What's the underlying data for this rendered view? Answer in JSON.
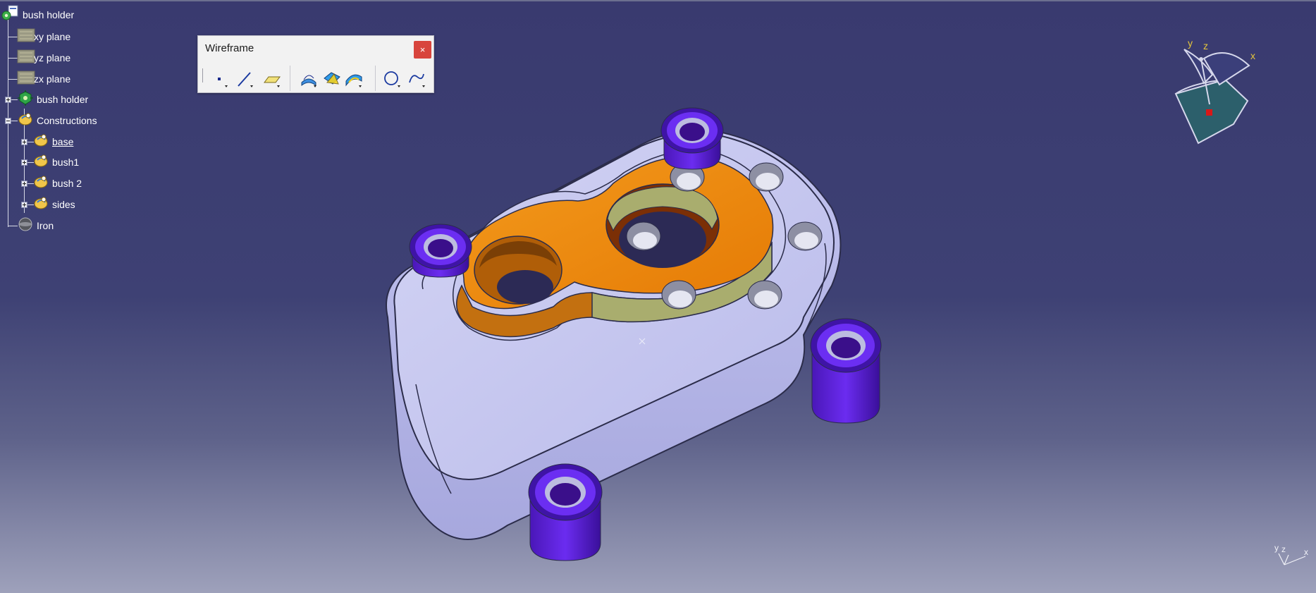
{
  "tree": {
    "root": {
      "label": "bush holder",
      "icon": "product-root-icon"
    },
    "items": [
      {
        "label": "xy plane",
        "icon": "plane-icon"
      },
      {
        "label": "yz plane",
        "icon": "plane-icon"
      },
      {
        "label": "zx plane",
        "icon": "plane-icon"
      },
      {
        "label": "bush holder",
        "icon": "part-body-icon"
      },
      {
        "label": "Constructions",
        "icon": "geometrical-set-icon"
      },
      {
        "label": "base",
        "icon": "geometrical-set-icon"
      },
      {
        "label": "bush1",
        "icon": "geometrical-set-icon"
      },
      {
        "label": "bush 2",
        "icon": "geometrical-set-icon"
      },
      {
        "label": "sides",
        "icon": "geometrical-set-icon"
      },
      {
        "label": "Iron",
        "icon": "material-icon"
      }
    ]
  },
  "toolbar": {
    "title": "Wireframe",
    "close_label": "×",
    "tools": [
      "point-icon",
      "line-icon",
      "plane-tool-icon",
      "projection-icon",
      "intersection-icon",
      "offset-icon",
      "circle-icon",
      "spline-icon"
    ]
  },
  "compass": {
    "x_label": "x",
    "y_label": "y",
    "z_label": "z"
  },
  "mini_axis": {
    "x_label": "x",
    "y_label": "y",
    "z_label": "z"
  },
  "colors": {
    "accent_part": "#f08a10",
    "bush": "#5a1fd0",
    "body": "#c8c9ef",
    "close": "#d8453d"
  }
}
